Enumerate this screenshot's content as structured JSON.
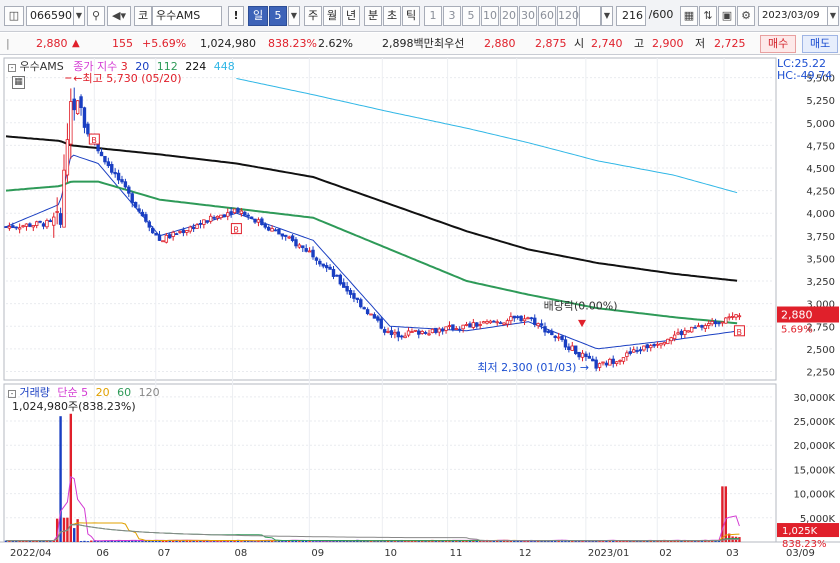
{
  "toolbar": {
    "code": "066590",
    "market_label": "코",
    "stock_name": "우수AMS",
    "period_day": "일",
    "period_num": "5",
    "periods": [
      "주",
      "월",
      "년",
      "분",
      "초",
      "틱"
    ],
    "intervals": [
      "1",
      "3",
      "5",
      "10",
      "20",
      "30",
      "60",
      "120"
    ],
    "count": "216",
    "count_total": "/600",
    "date": "2023/03/09"
  },
  "quote": {
    "price": "2,880",
    "change_arrow": "▲",
    "change": "155",
    "change_pct": "+5.69%",
    "volume": "1,024,980",
    "volume_ratio": "838.23%",
    "turnover": "2.62%",
    "amount": "2,898백만",
    "best_ask_label": "최우선",
    "best_ask": "2,880",
    "best_bid": "2,875",
    "open_label": "시",
    "open": "2,740",
    "high_label": "고",
    "high": "2,900",
    "low_label": "저",
    "low": "2,725",
    "buy": "매수",
    "sell": "매도"
  },
  "price_panel": {
    "name": "우수AMS",
    "legend_title": "종가 지수",
    "ma": [
      {
        "label": "3",
        "color": "#e0202b"
      },
      {
        "label": "20",
        "color": "#1a3fc2"
      },
      {
        "label": "112",
        "color": "#2e9a58"
      },
      {
        "label": "224",
        "color": "#111111"
      },
      {
        "label": "448",
        "color": "#31b7e6"
      }
    ],
    "high_note": "최고 5,730 (05/20)",
    "low_note": "최저 2,300 (01/03)",
    "ex_note": "배당락(0.00%)",
    "lc": "LC:25.22",
    "hc": "HC:-49.74",
    "last_price": "2,880",
    "last_pct": "5.69%",
    "y_ticks": [
      "5,500",
      "5,250",
      "5,000",
      "4,750",
      "4,500",
      "4,250",
      "4,000",
      "3,750",
      "3,500",
      "3,250",
      "3,000",
      "2,750",
      "2,500",
      "2,250"
    ]
  },
  "volume_panel": {
    "legend_title": "거래량",
    "legend_sub": "단순",
    "ma": [
      {
        "label": "5",
        "color": "#d33ad3"
      },
      {
        "label": "20",
        "color": "#e0a000"
      },
      {
        "label": "60",
        "color": "#2e9a58"
      },
      {
        "label": "120",
        "color": "#888888"
      }
    ],
    "value_note": "1,024,980주(838.23%)",
    "last_volume": "1,025K",
    "last_pct": "838.23%",
    "y_ticks": [
      "30,000K",
      "25,000K",
      "20,000K",
      "15,000K",
      "10,000K",
      "5,000K"
    ]
  },
  "x_axis": [
    "2022/04",
    "06",
    "07",
    "08",
    "09",
    "10",
    "11",
    "12",
    "2023/01",
    "02",
    "03",
    "03/09"
  ],
  "chart_data": {
    "type": "line",
    "title": "우수AMS",
    "x": [
      "2022/04",
      "2022/05",
      "2022/05/20",
      "2022/06",
      "2022/07",
      "2022/08",
      "2022/09",
      "2022/10",
      "2022/11",
      "2022/12",
      "2023/01/03",
      "2023/02",
      "2023/03/09"
    ],
    "series": [
      {
        "name": "종가",
        "values": [
          3850,
          3900,
          5300,
          4700,
          3700,
          4050,
          3550,
          2650,
          2750,
          2850,
          2300,
          2650,
          2880
        ]
      },
      {
        "name": "20",
        "values": [
          3850,
          4100,
          4650,
          4550,
          3750,
          4000,
          3700,
          2750,
          2700,
          2800,
          2500,
          2600,
          2700
        ]
      },
      {
        "name": "112",
        "values": [
          4250,
          4300,
          4350,
          4350,
          4150,
          4050,
          3950,
          3600,
          3250,
          3100,
          2950,
          2850,
          2780
        ]
      },
      {
        "name": "224",
        "values": [
          4850,
          4800,
          4750,
          4720,
          4650,
          4550,
          4400,
          4100,
          3800,
          3600,
          3450,
          3330,
          3250
        ]
      },
      {
        "name": "448",
        "values": [
          null,
          null,
          null,
          null,
          null,
          5490,
          5310,
          5120,
          4940,
          4780,
          4580,
          4420,
          4220
        ]
      }
    ],
    "volume": {
      "name": "거래량",
      "unit": "K",
      "max_label": "30,000K",
      "last": 1025
    },
    "ylim": [
      2200,
      5650
    ],
    "annotations": [
      "최고 5,730 (05/20)",
      "최저 2,300 (01/03)",
      "배당락(0.00%)"
    ]
  }
}
